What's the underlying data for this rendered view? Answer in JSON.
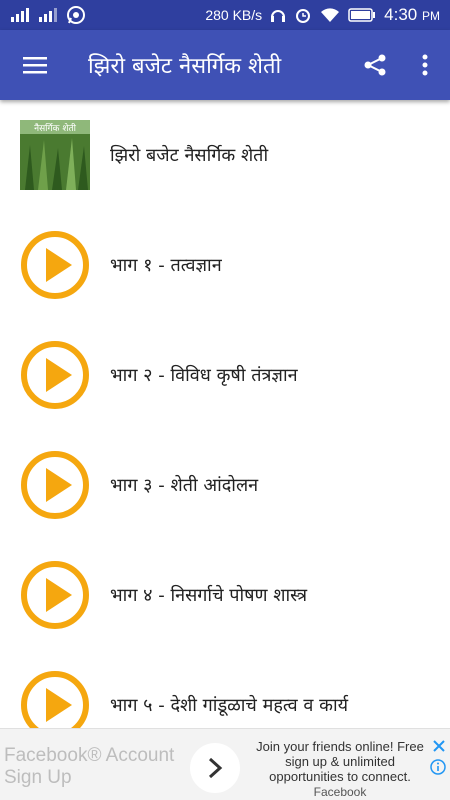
{
  "status_bar": {
    "speed": "280 KB/s",
    "time": "4:30",
    "ampm": "PM"
  },
  "appbar": {
    "title": "झिरो  बजेट नैसर्गिक शेती",
    "menu_icon": "hamburger-icon",
    "share_icon": "share-icon",
    "more_icon": "more-vert-icon"
  },
  "list": {
    "header_item": {
      "label": "झिरो बजेट नैसर्गिक शेती",
      "thumb_text": "नैसर्गिक शेती"
    },
    "items": [
      {
        "label": "भाग १ - तत्वज्ञान"
      },
      {
        "label": "भाग २ - विविध कृषी तंत्रज्ञान"
      },
      {
        "label": "भाग ३ - शेती आंदोलन"
      },
      {
        "label": "भाग ४ - निसर्गाचे पोषण शास्त्र"
      },
      {
        "label": "भाग ५ - देशी गांडूळाचे महत्व व कार्य"
      }
    ]
  },
  "ad": {
    "left_text": "Facebook® Account Sign Up",
    "right_text": "Join your friends online! Free sign up & unlimited opportunities to connect.",
    "brand": "Facebook"
  },
  "colors": {
    "appbar": "#3f51b5",
    "status": "#2f3f9f",
    "play": "#f5a70f"
  }
}
